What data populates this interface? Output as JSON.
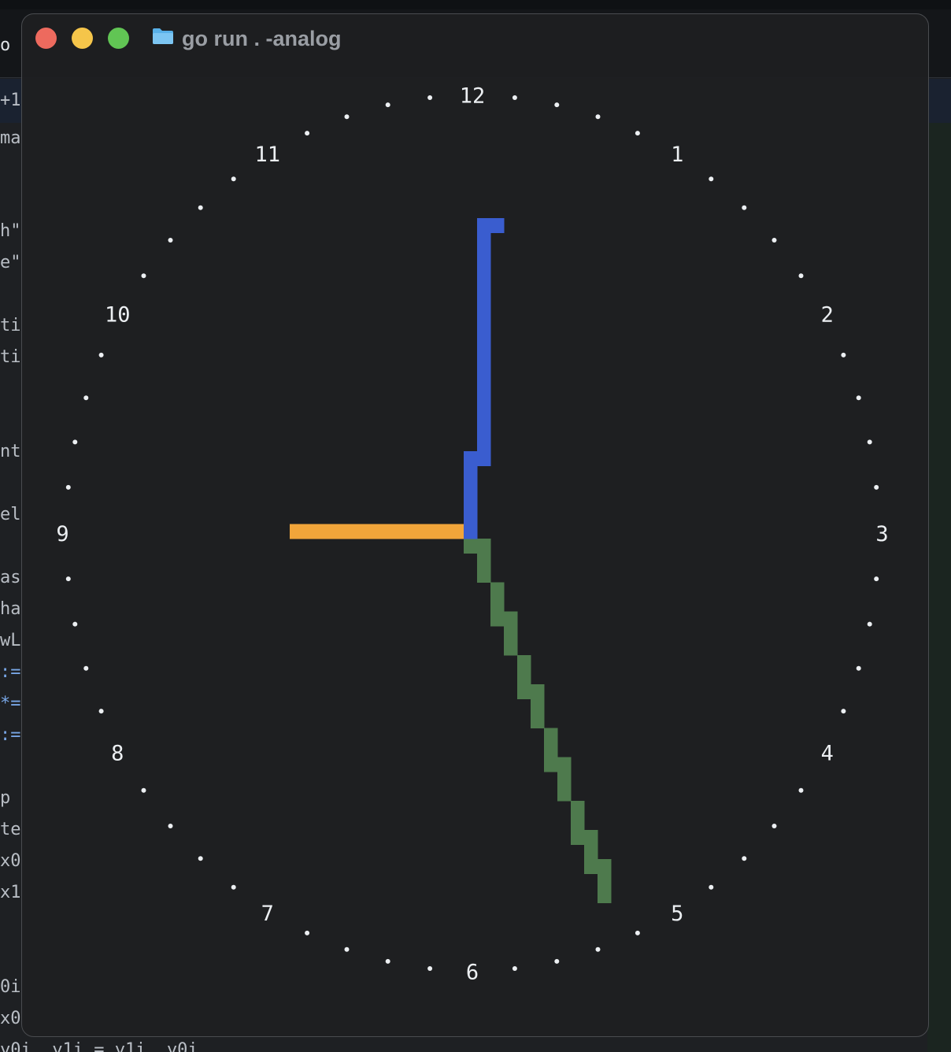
{
  "background_editor": {
    "lines": [
      {
        "text": "o",
        "color": "#dfe2e6"
      },
      {
        "text": "+1",
        "color": "#b9bec5"
      },
      {
        "text": "ma",
        "color": "#b9bec5"
      },
      {
        "text": "h\"",
        "color": "#b9bec5"
      },
      {
        "text": "e\"",
        "color": "#b9bec5"
      },
      {
        "text": "ti",
        "color": "#b9bec5"
      },
      {
        "text": "ti",
        "color": "#b9bec5"
      },
      {
        "text": "nt",
        "color": "#b9bec5"
      },
      {
        "text": "el",
        "color": "#b9bec5"
      },
      {
        "text": "as",
        "color": "#b9bec5"
      },
      {
        "text": "ha",
        "color": "#b9bec5"
      },
      {
        "text": "wL",
        "color": "#b9bec5"
      },
      {
        "text": ":=",
        "color": "#78a6e6"
      },
      {
        "text": "*=",
        "color": "#78a6e6"
      },
      {
        "text": ":=",
        "color": "#78a6e6"
      },
      {
        "text": "p",
        "color": "#b9bec5"
      },
      {
        "text": "te",
        "color": "#b9bec5"
      },
      {
        "text": "x0",
        "color": "#b9bec5"
      },
      {
        "text": "x1",
        "color": "#b9bec5"
      },
      {
        "text": "0i",
        "color": "#b9bec5"
      },
      {
        "text": "x0",
        "color": "#b9bec5"
      },
      {
        "text": "y0i, y1i = y1i, y0i",
        "color": "#b9bec5"
      }
    ]
  },
  "window": {
    "title": "go run . -analog",
    "folder_icon": "folder-icon",
    "buttons": {
      "close": {
        "icon": "close-dot",
        "color": "#ed6a5e"
      },
      "minimize": {
        "icon": "minimize-dot",
        "color": "#f5c54a"
      },
      "maximize": {
        "icon": "maximize-dot",
        "color": "#61c554"
      }
    }
  },
  "clock": {
    "numerals": [
      "12",
      "1",
      "2",
      "3",
      "4",
      "5",
      "6",
      "7",
      "8",
      "9",
      "10",
      "11"
    ],
    "time": {
      "hour": 9,
      "minute": 1,
      "second": 26
    },
    "colors": {
      "hour_hand": "#f1a53a",
      "minute_hand": "#3a5dcf",
      "second_hand": "#4e7a4d",
      "tick": "#eceff2"
    }
  }
}
